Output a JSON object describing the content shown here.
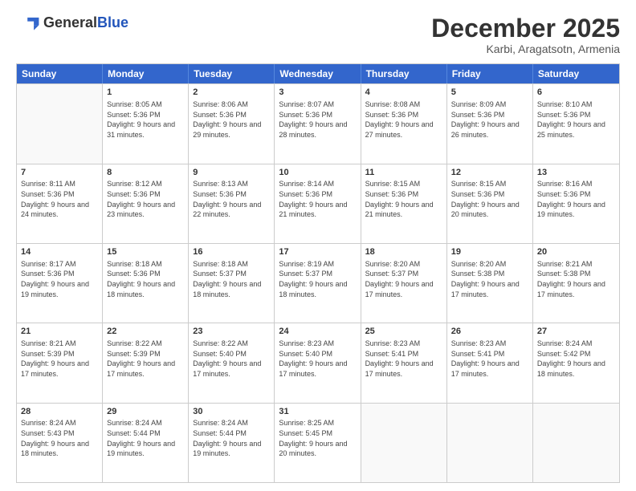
{
  "header": {
    "logo_general": "General",
    "logo_blue": "Blue",
    "month_title": "December 2025",
    "subtitle": "Karbi, Aragatsotn, Armenia"
  },
  "weekdays": [
    "Sunday",
    "Monday",
    "Tuesday",
    "Wednesday",
    "Thursday",
    "Friday",
    "Saturday"
  ],
  "rows": [
    [
      {
        "day": "",
        "sunrise": "",
        "sunset": "",
        "daylight": ""
      },
      {
        "day": "1",
        "sunrise": "Sunrise: 8:05 AM",
        "sunset": "Sunset: 5:36 PM",
        "daylight": "Daylight: 9 hours and 31 minutes."
      },
      {
        "day": "2",
        "sunrise": "Sunrise: 8:06 AM",
        "sunset": "Sunset: 5:36 PM",
        "daylight": "Daylight: 9 hours and 29 minutes."
      },
      {
        "day": "3",
        "sunrise": "Sunrise: 8:07 AM",
        "sunset": "Sunset: 5:36 PM",
        "daylight": "Daylight: 9 hours and 28 minutes."
      },
      {
        "day": "4",
        "sunrise": "Sunrise: 8:08 AM",
        "sunset": "Sunset: 5:36 PM",
        "daylight": "Daylight: 9 hours and 27 minutes."
      },
      {
        "day": "5",
        "sunrise": "Sunrise: 8:09 AM",
        "sunset": "Sunset: 5:36 PM",
        "daylight": "Daylight: 9 hours and 26 minutes."
      },
      {
        "day": "6",
        "sunrise": "Sunrise: 8:10 AM",
        "sunset": "Sunset: 5:36 PM",
        "daylight": "Daylight: 9 hours and 25 minutes."
      }
    ],
    [
      {
        "day": "7",
        "sunrise": "Sunrise: 8:11 AM",
        "sunset": "Sunset: 5:36 PM",
        "daylight": "Daylight: 9 hours and 24 minutes."
      },
      {
        "day": "8",
        "sunrise": "Sunrise: 8:12 AM",
        "sunset": "Sunset: 5:36 PM",
        "daylight": "Daylight: 9 hours and 23 minutes."
      },
      {
        "day": "9",
        "sunrise": "Sunrise: 8:13 AM",
        "sunset": "Sunset: 5:36 PM",
        "daylight": "Daylight: 9 hours and 22 minutes."
      },
      {
        "day": "10",
        "sunrise": "Sunrise: 8:14 AM",
        "sunset": "Sunset: 5:36 PM",
        "daylight": "Daylight: 9 hours and 21 minutes."
      },
      {
        "day": "11",
        "sunrise": "Sunrise: 8:15 AM",
        "sunset": "Sunset: 5:36 PM",
        "daylight": "Daylight: 9 hours and 21 minutes."
      },
      {
        "day": "12",
        "sunrise": "Sunrise: 8:15 AM",
        "sunset": "Sunset: 5:36 PM",
        "daylight": "Daylight: 9 hours and 20 minutes."
      },
      {
        "day": "13",
        "sunrise": "Sunrise: 8:16 AM",
        "sunset": "Sunset: 5:36 PM",
        "daylight": "Daylight: 9 hours and 19 minutes."
      }
    ],
    [
      {
        "day": "14",
        "sunrise": "Sunrise: 8:17 AM",
        "sunset": "Sunset: 5:36 PM",
        "daylight": "Daylight: 9 hours and 19 minutes."
      },
      {
        "day": "15",
        "sunrise": "Sunrise: 8:18 AM",
        "sunset": "Sunset: 5:36 PM",
        "daylight": "Daylight: 9 hours and 18 minutes."
      },
      {
        "day": "16",
        "sunrise": "Sunrise: 8:18 AM",
        "sunset": "Sunset: 5:37 PM",
        "daylight": "Daylight: 9 hours and 18 minutes."
      },
      {
        "day": "17",
        "sunrise": "Sunrise: 8:19 AM",
        "sunset": "Sunset: 5:37 PM",
        "daylight": "Daylight: 9 hours and 18 minutes."
      },
      {
        "day": "18",
        "sunrise": "Sunrise: 8:20 AM",
        "sunset": "Sunset: 5:37 PM",
        "daylight": "Daylight: 9 hours and 17 minutes."
      },
      {
        "day": "19",
        "sunrise": "Sunrise: 8:20 AM",
        "sunset": "Sunset: 5:38 PM",
        "daylight": "Daylight: 9 hours and 17 minutes."
      },
      {
        "day": "20",
        "sunrise": "Sunrise: 8:21 AM",
        "sunset": "Sunset: 5:38 PM",
        "daylight": "Daylight: 9 hours and 17 minutes."
      }
    ],
    [
      {
        "day": "21",
        "sunrise": "Sunrise: 8:21 AM",
        "sunset": "Sunset: 5:39 PM",
        "daylight": "Daylight: 9 hours and 17 minutes."
      },
      {
        "day": "22",
        "sunrise": "Sunrise: 8:22 AM",
        "sunset": "Sunset: 5:39 PM",
        "daylight": "Daylight: 9 hours and 17 minutes."
      },
      {
        "day": "23",
        "sunrise": "Sunrise: 8:22 AM",
        "sunset": "Sunset: 5:40 PM",
        "daylight": "Daylight: 9 hours and 17 minutes."
      },
      {
        "day": "24",
        "sunrise": "Sunrise: 8:23 AM",
        "sunset": "Sunset: 5:40 PM",
        "daylight": "Daylight: 9 hours and 17 minutes."
      },
      {
        "day": "25",
        "sunrise": "Sunrise: 8:23 AM",
        "sunset": "Sunset: 5:41 PM",
        "daylight": "Daylight: 9 hours and 17 minutes."
      },
      {
        "day": "26",
        "sunrise": "Sunrise: 8:23 AM",
        "sunset": "Sunset: 5:41 PM",
        "daylight": "Daylight: 9 hours and 17 minutes."
      },
      {
        "day": "27",
        "sunrise": "Sunrise: 8:24 AM",
        "sunset": "Sunset: 5:42 PM",
        "daylight": "Daylight: 9 hours and 18 minutes."
      }
    ],
    [
      {
        "day": "28",
        "sunrise": "Sunrise: 8:24 AM",
        "sunset": "Sunset: 5:43 PM",
        "daylight": "Daylight: 9 hours and 18 minutes."
      },
      {
        "day": "29",
        "sunrise": "Sunrise: 8:24 AM",
        "sunset": "Sunset: 5:44 PM",
        "daylight": "Daylight: 9 hours and 19 minutes."
      },
      {
        "day": "30",
        "sunrise": "Sunrise: 8:24 AM",
        "sunset": "Sunset: 5:44 PM",
        "daylight": "Daylight: 9 hours and 19 minutes."
      },
      {
        "day": "31",
        "sunrise": "Sunrise: 8:25 AM",
        "sunset": "Sunset: 5:45 PM",
        "daylight": "Daylight: 9 hours and 20 minutes."
      },
      {
        "day": "",
        "sunrise": "",
        "sunset": "",
        "daylight": ""
      },
      {
        "day": "",
        "sunrise": "",
        "sunset": "",
        "daylight": ""
      },
      {
        "day": "",
        "sunrise": "",
        "sunset": "",
        "daylight": ""
      }
    ]
  ]
}
